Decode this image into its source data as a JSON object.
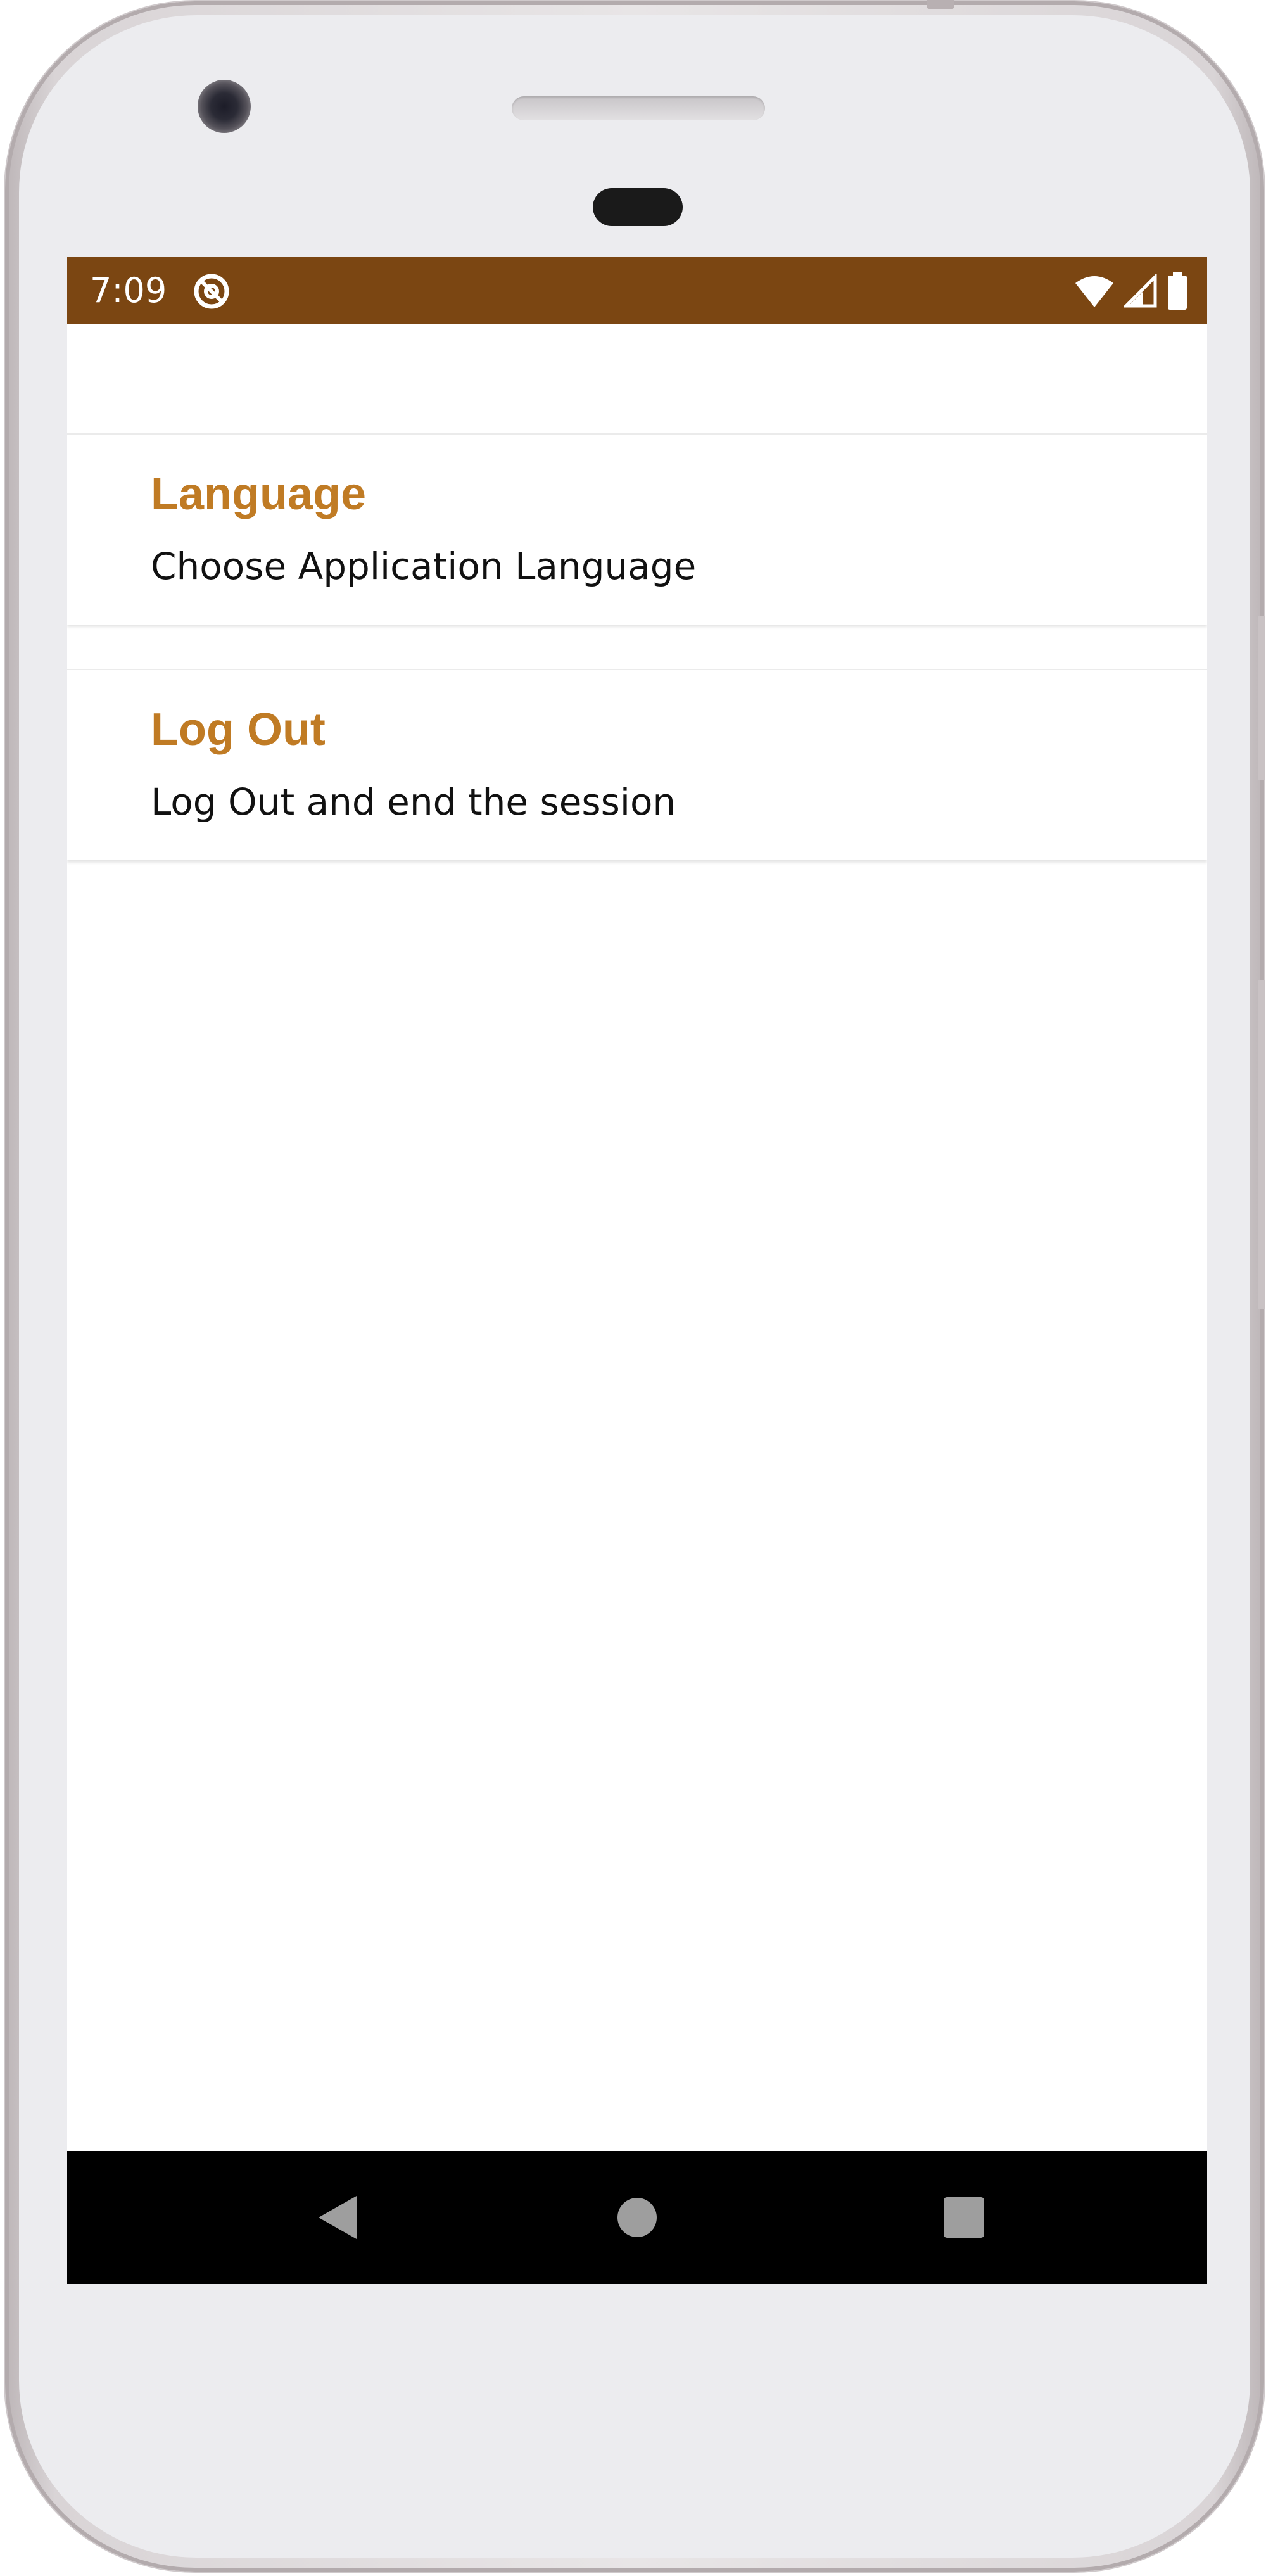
{
  "status_bar": {
    "time": "7:09",
    "background": "#7b4612",
    "icons": [
      "app-notification-icon",
      "wifi-icon",
      "cell-signal-icon",
      "battery-icon"
    ]
  },
  "settings": {
    "items": [
      {
        "title": "Language",
        "subtitle": "Choose Application Language"
      },
      {
        "title": "Log Out",
        "subtitle": "Log Out and end the session"
      }
    ],
    "title_color": "#c07b24"
  },
  "nav_bar": {
    "buttons": [
      "back-icon",
      "home-icon",
      "recents-icon"
    ]
  }
}
